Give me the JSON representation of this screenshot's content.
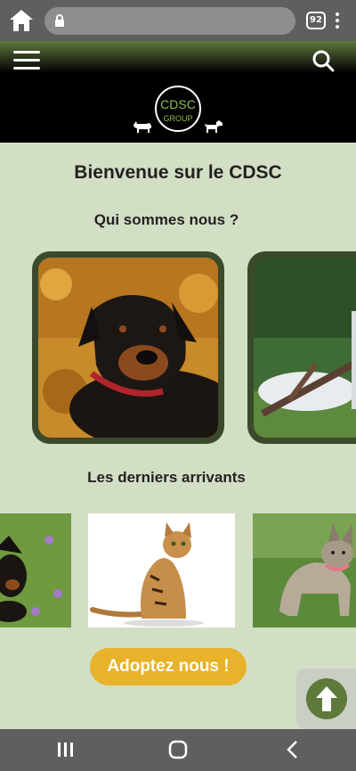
{
  "browser": {
    "tab_count": "92",
    "url": ""
  },
  "header": {
    "logo_text": "CDSC",
    "logo_sub": "GROUP"
  },
  "main": {
    "welcome": "Bienvenue sur le CDSC",
    "who_title": "Qui sommes nous ?",
    "latest_title": "Les derniers arrivants",
    "adopt_button": "Adoptez nous !"
  },
  "colors": {
    "brand_green": "#5e7a3a",
    "page_bg": "#d3dfc5",
    "button_yellow": "#e8b22a"
  },
  "icons": [
    "home-icon",
    "lock-icon",
    "tabs-icon",
    "more-icon",
    "menu-icon",
    "search-icon",
    "arrow-up-icon",
    "recent-apps-icon",
    "home-circle-icon",
    "back-icon"
  ]
}
